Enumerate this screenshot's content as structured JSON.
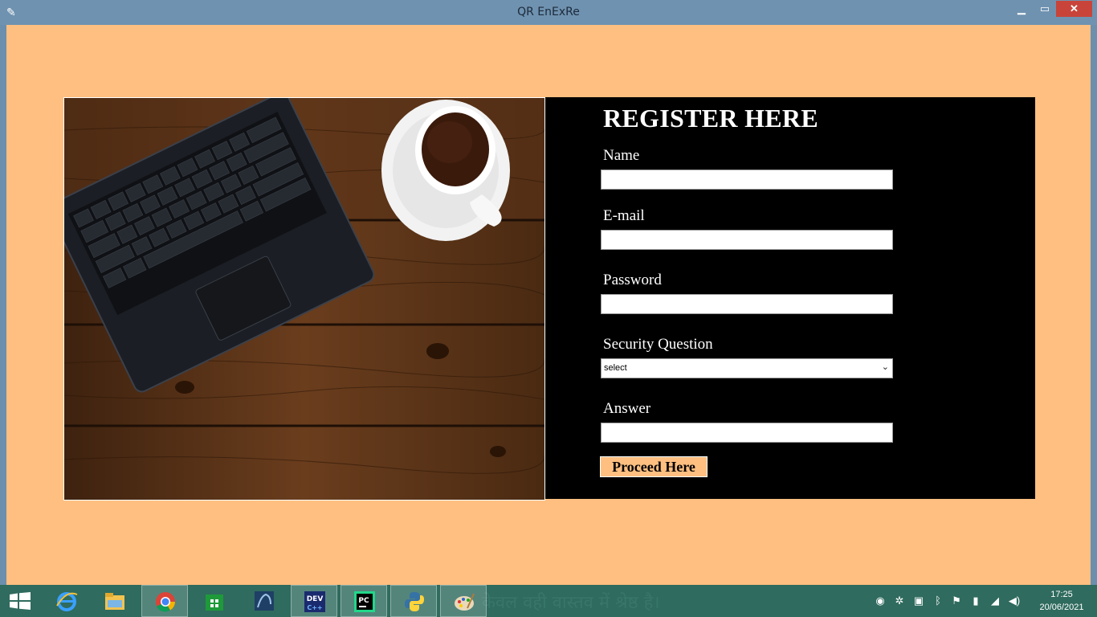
{
  "window": {
    "title": "QR EnExRe",
    "app_icon": "feather-icon"
  },
  "form": {
    "heading": "REGISTER HERE",
    "name_label": "Name",
    "name_value": "",
    "email_label": "E-mail",
    "email_value": "",
    "password_label": "Password",
    "password_value": "",
    "security_label": "Security Question",
    "security_selected": "select",
    "answer_label": "Answer",
    "answer_value": "",
    "submit_label": "Proceed Here"
  },
  "taskbar": {
    "background_text": "केवल वही वास्तव में श्रेष्ठ है।",
    "items": [
      {
        "name": "internet-explorer-icon"
      },
      {
        "name": "file-explorer-icon"
      },
      {
        "name": "chrome-icon"
      },
      {
        "name": "store-icon"
      },
      {
        "name": "mysql-icon"
      },
      {
        "name": "devcpp-icon",
        "label": "DEV"
      },
      {
        "name": "pycharm-icon",
        "label": "PC"
      },
      {
        "name": "python-icon"
      },
      {
        "name": "paint-icon"
      }
    ],
    "clock_time": "17:25",
    "clock_date": "20/06/2021"
  },
  "colors": {
    "client_bg": "#ffbf80",
    "form_bg": "#000000",
    "button_bg": "#ffbf80",
    "titlebar": "#6f92b0",
    "close": "#c8443a"
  }
}
